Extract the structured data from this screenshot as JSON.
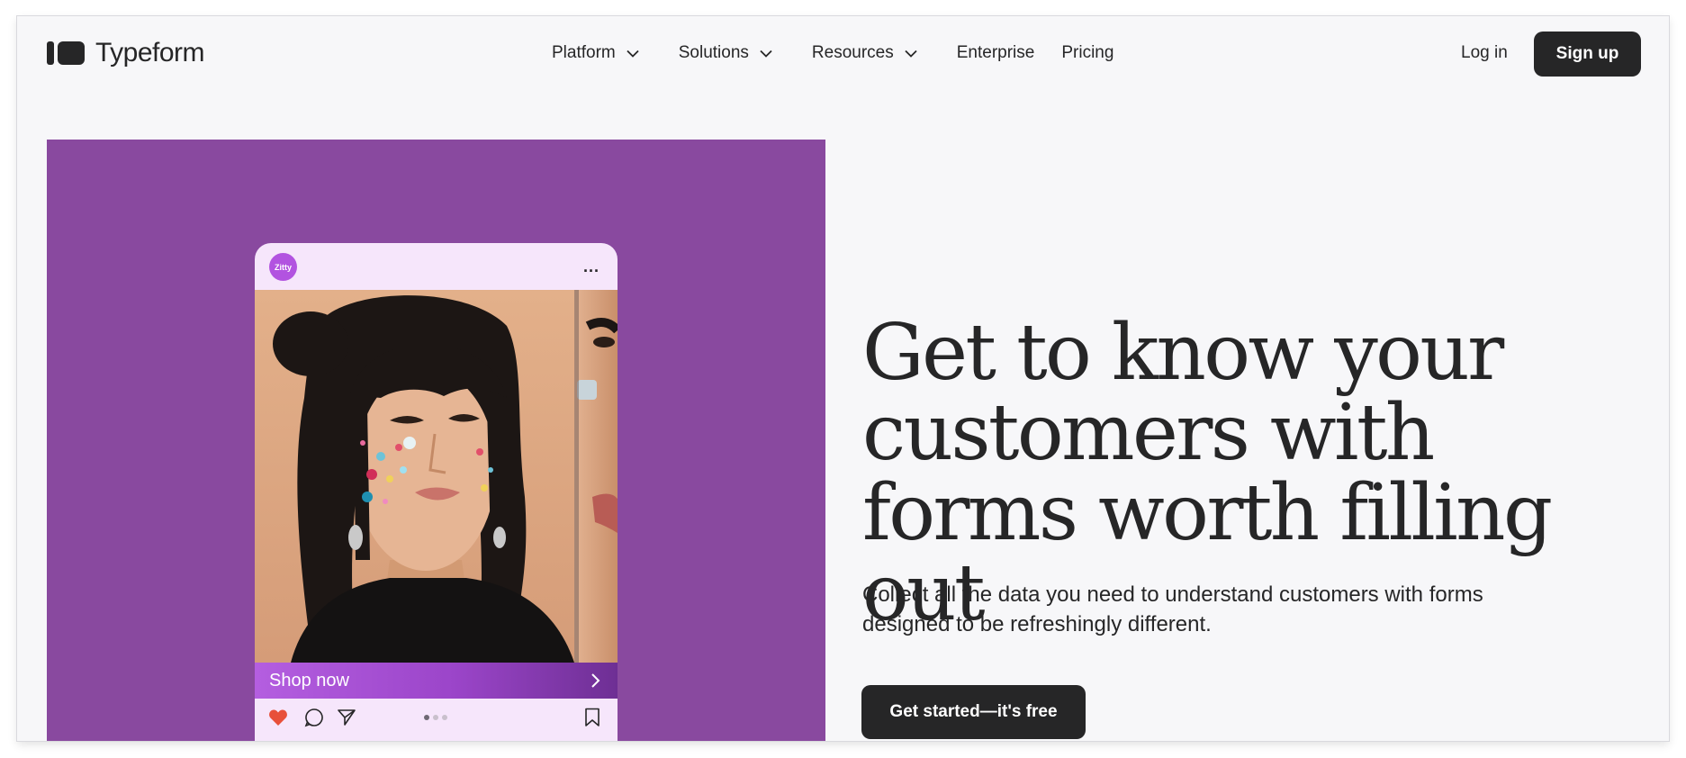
{
  "brand": {
    "name": "Typeform",
    "logo_icon": "typeform-logo-icon"
  },
  "nav": {
    "items": [
      {
        "label": "Platform",
        "has_dropdown": true
      },
      {
        "label": "Solutions",
        "has_dropdown": true
      },
      {
        "label": "Resources",
        "has_dropdown": true
      },
      {
        "label": "Enterprise",
        "has_dropdown": false
      },
      {
        "label": "Pricing",
        "has_dropdown": false
      }
    ],
    "login_label": "Log in",
    "signup_label": "Sign up"
  },
  "hero": {
    "headline": "Get to know your customers with forms worth filling out",
    "subtext": "Collect all the data you need to understand customers with forms designed to be refreshingly different.",
    "cta_label": "Get started—it's free",
    "media": {
      "avatar_text": "Zitty",
      "more_icon": "...",
      "shop_label": "Shop now",
      "icons": [
        "heart-icon",
        "comment-icon",
        "share-icon",
        "bookmark-icon"
      ],
      "carousel_pages": 3,
      "carousel_active": 1
    }
  },
  "colors": {
    "accent_purple": "#89499f",
    "dark": "#262627",
    "background": "#f7f7f9",
    "heart": "#e8503a"
  }
}
